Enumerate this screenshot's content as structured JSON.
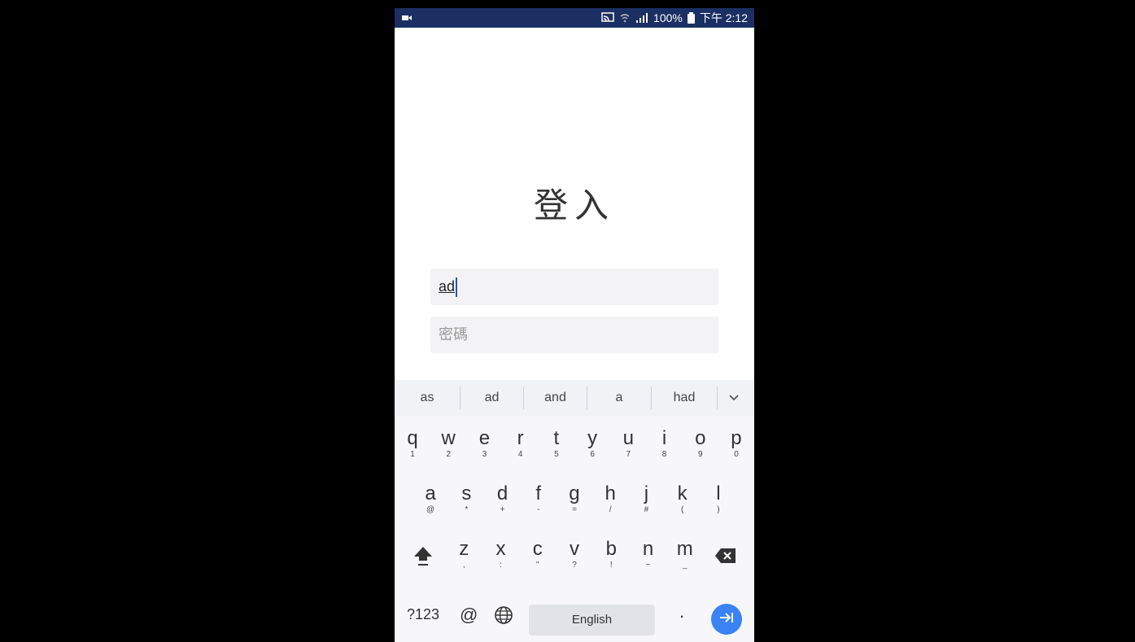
{
  "status_bar": {
    "battery": "100%",
    "time": "下午 2:12"
  },
  "login": {
    "title": "登入",
    "username_value": "ad",
    "password_placeholder": "密碼"
  },
  "keyboard": {
    "suggestions": [
      "as",
      "ad",
      "and",
      "a",
      "had"
    ],
    "row1": [
      {
        "main": "q",
        "sub": "1"
      },
      {
        "main": "w",
        "sub": "2"
      },
      {
        "main": "e",
        "sub": "3"
      },
      {
        "main": "r",
        "sub": "4"
      },
      {
        "main": "t",
        "sub": "5"
      },
      {
        "main": "y",
        "sub": "6"
      },
      {
        "main": "u",
        "sub": "7"
      },
      {
        "main": "i",
        "sub": "8"
      },
      {
        "main": "o",
        "sub": "9"
      },
      {
        "main": "p",
        "sub": "0"
      }
    ],
    "row2": [
      {
        "main": "a",
        "sub": "@"
      },
      {
        "main": "s",
        "sub": "*"
      },
      {
        "main": "d",
        "sub": "+"
      },
      {
        "main": "f",
        "sub": "-"
      },
      {
        "main": "g",
        "sub": "="
      },
      {
        "main": "h",
        "sub": "/"
      },
      {
        "main": "j",
        "sub": "#"
      },
      {
        "main": "k",
        "sub": "("
      },
      {
        "main": "l",
        "sub": ")"
      }
    ],
    "row3": [
      {
        "main": "z",
        "sub": ","
      },
      {
        "main": "x",
        "sub": ":"
      },
      {
        "main": "c",
        "sub": "\""
      },
      {
        "main": "v",
        "sub": "?"
      },
      {
        "main": "b",
        "sub": "!"
      },
      {
        "main": "n",
        "sub": "~"
      },
      {
        "main": "m",
        "sub": "_"
      }
    ],
    "bottom": {
      "symbols": "?123",
      "at": "@",
      "space_label": "English",
      "period": "."
    }
  }
}
